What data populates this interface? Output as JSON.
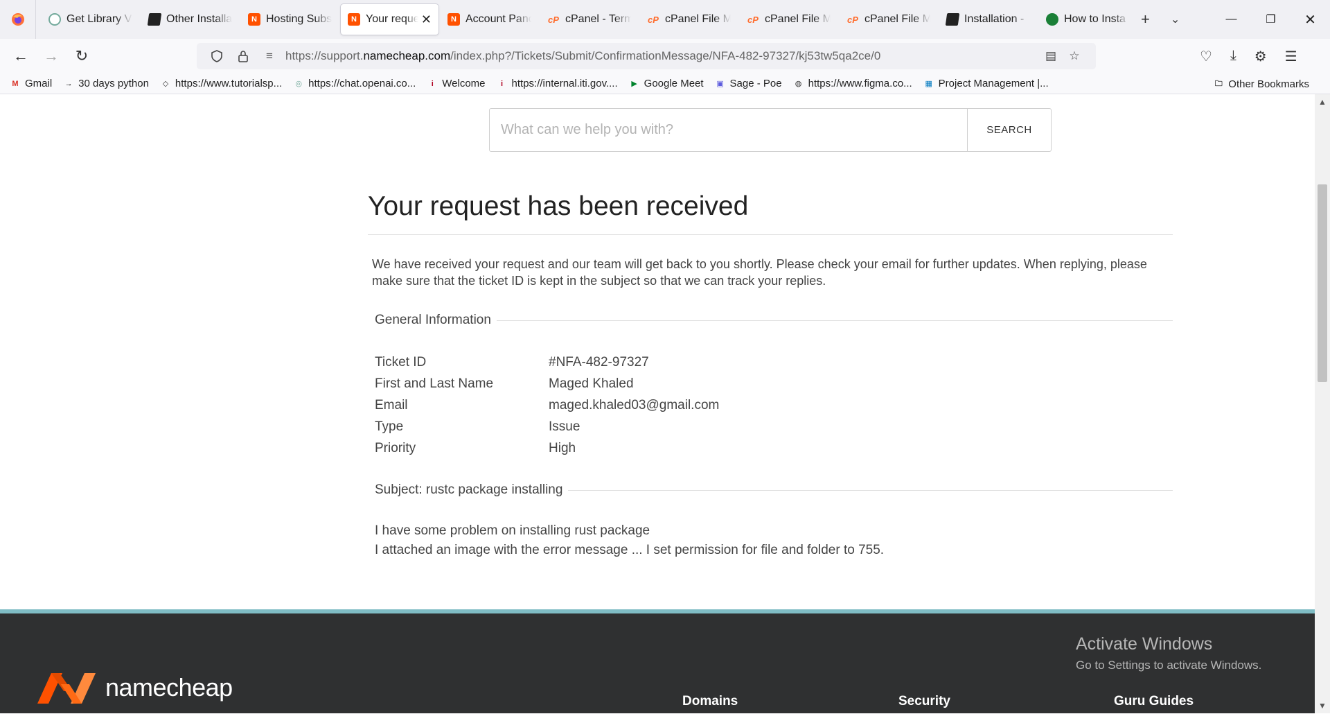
{
  "browser": {
    "tabs": [
      {
        "label": "Get Library V",
        "icon": "chatgpt-icon"
      },
      {
        "label": "Other Installa",
        "icon": "document-icon"
      },
      {
        "label": "Hosting Subs",
        "icon": "namecheap-icon"
      },
      {
        "label": "Your reque",
        "icon": "namecheap-icon",
        "active": true
      },
      {
        "label": "Account Panc",
        "icon": "namecheap-icon"
      },
      {
        "label": "cPanel - Term",
        "icon": "cpanel-icon"
      },
      {
        "label": "cPanel File M",
        "icon": "cpanel-icon"
      },
      {
        "label": "cPanel File M",
        "icon": "cpanel-icon"
      },
      {
        "label": "cPanel File M",
        "icon": "cpanel-icon"
      },
      {
        "label": "Installation -",
        "icon": "document-icon"
      },
      {
        "label": "How to Insta",
        "icon": "github-icon"
      }
    ],
    "url_prefix": "https://support.",
    "url_domain": "namecheap.com",
    "url_path": "/index.php?/Tickets/Submit/ConfirmationMessage/NFA-482-97327/kj53tw5qa2ce/0",
    "bookmarks": [
      {
        "label": "Gmail",
        "icon": "gmail-icon"
      },
      {
        "label": "30 days python",
        "icon": "terminal-icon"
      },
      {
        "label": "https://www.tutorialsp...",
        "icon": "tutorialspoint-icon"
      },
      {
        "label": "https://chat.openai.co...",
        "icon": "chatgpt-icon"
      },
      {
        "label": "Welcome",
        "icon": "iti-icon"
      },
      {
        "label": "https://internal.iti.gov....",
        "icon": "iti-icon"
      },
      {
        "label": "Google Meet",
        "icon": "meet-icon"
      },
      {
        "label": "Sage - Poe",
        "icon": "poe-icon"
      },
      {
        "label": "https://www.figma.co...",
        "icon": "globe-icon"
      },
      {
        "label": "Project Management |...",
        "icon": "trello-icon"
      }
    ],
    "other_bookmarks": "Other Bookmarks"
  },
  "search": {
    "placeholder": "What can we help you with?",
    "button": "SEARCH"
  },
  "page": {
    "title": "Your request has been received",
    "intro": "We have received your request and our team will get back to you shortly. Please check your email for further updates. When replying, please make sure that the ticket ID is kept in the subject so that we can track your replies.",
    "general_heading": "General Information",
    "fields": [
      {
        "label": "Ticket ID",
        "value": "#NFA-482-97327"
      },
      {
        "label": "First and Last Name",
        "value": "Maged Khaled"
      },
      {
        "label": "Email",
        "value": "maged.khaled03@gmail.com"
      },
      {
        "label": "Type",
        "value": "Issue"
      },
      {
        "label": "Priority",
        "value": "High"
      }
    ],
    "subject_heading": "Subject: rustc package installing",
    "message_lines": [
      "I have some problem on installing rust package",
      "I attached an image with the error message ... I set permission for file and folder to 755."
    ]
  },
  "footer": {
    "brand": "namecheap",
    "columns": [
      "Domains",
      "Security",
      "Guru Guides"
    ]
  },
  "watermark": {
    "line1": "Activate Windows",
    "line2": "Go to Settings to activate Windows."
  },
  "colors": {
    "namecheap_orange": "#ff5100",
    "footer_bg": "#2f3031",
    "footer_accent": "#7fbcc4"
  }
}
